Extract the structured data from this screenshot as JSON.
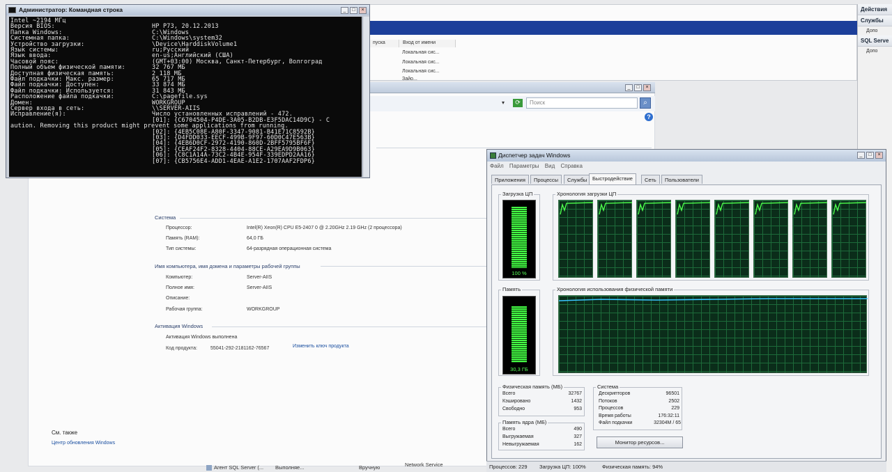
{
  "cmd": {
    "title": "Администратор: Командная строка",
    "lines": [
      [
        "Intel ~2194 МГц",
        ""
      ],
      [
        "Версия BIOS:",
        "HP P73, 20.12.2013"
      ],
      [
        "Папка Windows:",
        "C:\\Windows"
      ],
      [
        "Системная папка:",
        "C:\\Windows\\system32"
      ],
      [
        "Устройство загрузки:",
        "\\Device\\HarddiskVolume1"
      ],
      [
        "Язык системы:",
        "ru;Русский"
      ],
      [
        "Язык ввода:",
        "en-us;Английский (США)"
      ],
      [
        "Часовой пояс:",
        "(GMT+03:00) Москва, Санкт-Петербург, Волгоград"
      ],
      [
        "Полный объем физической памяти:",
        "32 767 МБ"
      ],
      [
        "Доступная физическая память:",
        "2 118 МБ"
      ],
      [
        "Файл подкачки: Макс. размер:",
        "65 717 МБ"
      ],
      [
        "Файл подкачки: Доступен:",
        "33 874 МБ"
      ],
      [
        "Файл подкачки: Используется:",
        "31 843 МБ"
      ],
      [
        "Расположение файла подкачки:",
        "C:\\pagefile.sys"
      ],
      [
        "Домен:",
        "WORKGROUP"
      ],
      [
        "Сервер входа в сеть:",
        "\\\\SERVER-AIIS"
      ],
      [
        "Исправление(я):",
        "Число установленных исправлений - 472."
      ]
    ],
    "hotfixes": [
      "[01]: {C6704504-P4DE-3A05-B2DB-E3F5DAC14D9C} - C",
      "[02]: {4EB5C08E-A80F-3347-9081-B41E71C8592B}",
      "[03]: {D4FDD033-EECF-499B-9F97-60D0C47E563B}",
      "[04]: {4EB6D0CF-2972-4190-860D-2BFF5795BF6F}",
      "[05]: {CEAF24F2-8328-4404-88CE-A29EA9D9B063}",
      "[06]: {C8C1A14A-73C2-4B4E-954F-339EDPD2AA16}",
      "[07]: {CB5756E4-ADD1-4EAE-A1E2-1707AAF2FDP6}"
    ],
    "wrap_line": "aution. Removing this product might prevent some applications from running."
  },
  "bg_header": {
    "col_startup": "пуска",
    "col_logon": "Вход от имени"
  },
  "bg_rows": [
    "Локальная сис...",
    "Локальная сис...",
    "Локальная сис...",
    "Локальная сис...",
    "Зайо..."
  ],
  "actions": {
    "title": "Действия",
    "items": [
      [
        "Службы",
        "Допо"
      ],
      [
        "SQL Serve",
        "Допо"
      ]
    ]
  },
  "explorer": {
    "search_placeholder": "Поиск"
  },
  "system": {
    "section_system": "Система",
    "cpu_label": "Процессор:",
    "cpu_value": "Intel(R) Xeon(R) CPU E5-2407 0 @ 2.20GHz   2.19 GHz  (2 процессора)",
    "ram_label": "Память (RAM):",
    "ram_value": "64,0 ГБ",
    "type_label": "Тип системы:",
    "type_value": "64-разрядная операционная система",
    "section_name": "Имя компьютера, имя домена и параметры рабочей группы",
    "comp_label": "Компьютер:",
    "comp_value": "Server-AIIS",
    "full_label": "Полное имя:",
    "full_value": "Server-AIIS",
    "desc_label": "Описание:",
    "wg_label": "Рабочая группа:",
    "wg_value": "WORKGROUP",
    "section_act": "Активация Windows",
    "act_status": "Активация Windows выполнена",
    "product_label": "Код продукта:",
    "product_value": "55041-292-2181162-76567",
    "change_key": "Изменить ключ продукта",
    "see_also": "См. также",
    "update_center": "Центр обновления Windows"
  },
  "bottom_service": {
    "name": "Агент SQL Server (...",
    "status": "Выполняе...",
    "startup": "Вручную",
    "account": "Network Service"
  },
  "taskmgr": {
    "title": "Диспетчер задач Windows",
    "menu": [
      "Файл",
      "Параметры",
      "Вид",
      "Справка"
    ],
    "tabs": [
      "Приложения",
      "Процессы",
      "Службы",
      "Быстродействие",
      "Сеть",
      "Пользователи"
    ],
    "active_tab": 3,
    "cpu_label": "Загрузка ЦП",
    "cpu_value": "100 %",
    "cpu_level": 1.0,
    "cpu_history_label": "Хронология загрузки ЦП",
    "mem_label": "Память",
    "mem_value": "30,3 ГБ",
    "mem_level": 0.94,
    "mem_history_label": "Хронология использования физической памяти",
    "phys_label": "Физическая память (МБ)",
    "phys": [
      [
        "Всего",
        "32767"
      ],
      [
        "Кэшировано",
        "1432"
      ],
      [
        "Свободно",
        "953"
      ]
    ],
    "kernel_label": "Память ядра (МБ)",
    "kernel": [
      [
        "Всего",
        "490"
      ],
      [
        "Выгружаемая",
        "327"
      ],
      [
        "Невыгружаемая",
        "162"
      ]
    ],
    "sys_label": "Система",
    "sys": [
      [
        "Дескрипторов",
        "96501"
      ],
      [
        "Потоков",
        "2502"
      ],
      [
        "Процессов",
        "229"
      ],
      [
        "Время работы",
        "176:32:11"
      ],
      [
        "Файл подкачки",
        "32304M / 65"
      ]
    ],
    "monitor_button": "Монитор ресурсов...",
    "status": {
      "processes": "Процессов: 229",
      "cpu": "Загрузка ЦП: 100%",
      "mem": "Физическая память: 94%"
    }
  }
}
